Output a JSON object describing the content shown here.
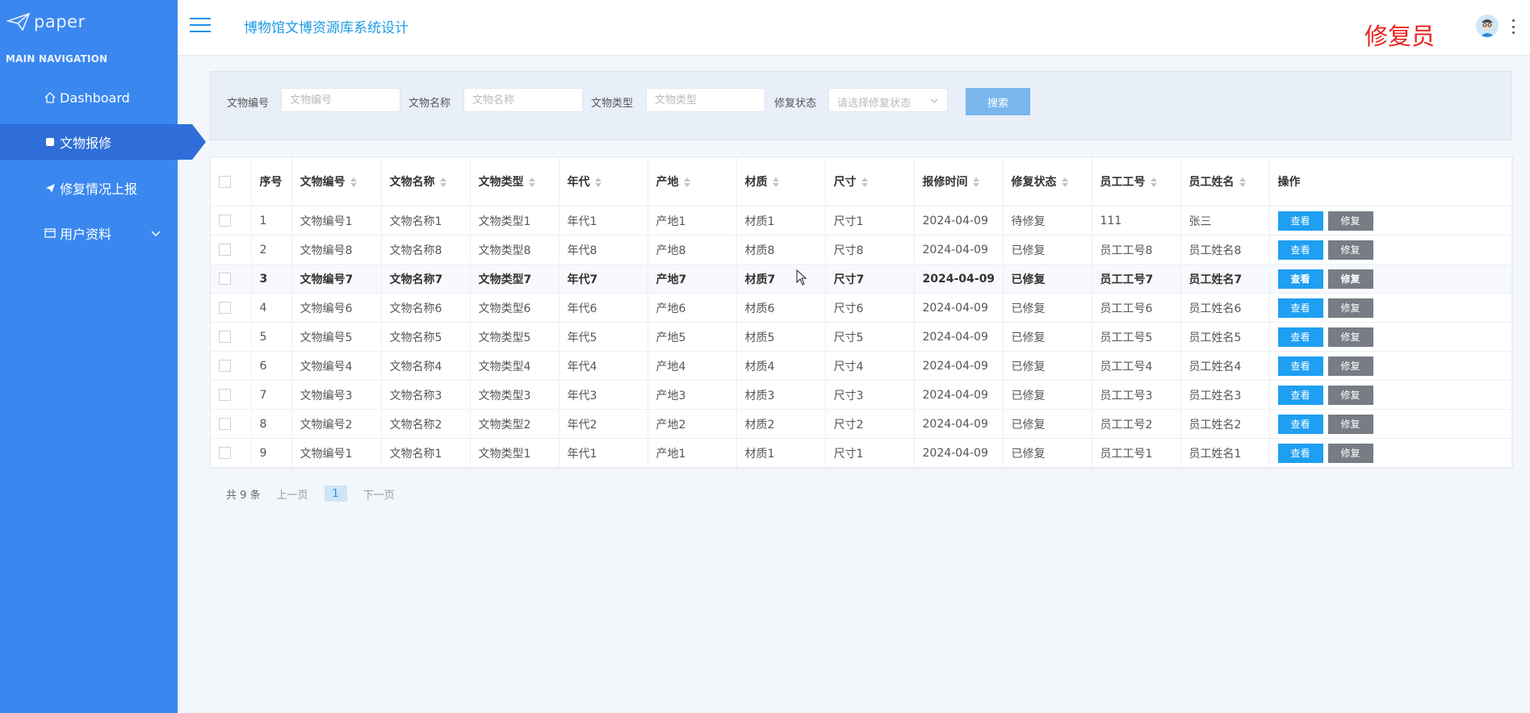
{
  "sidebar": {
    "logo_text": "paper",
    "nav_header": "MAIN NAVIGATION",
    "items": [
      {
        "label": "Dashboard",
        "icon": "home-icon"
      },
      {
        "label": "文物报修",
        "icon": "box-icon"
      },
      {
        "label": "修复情况上报",
        "icon": "paper-plane-icon"
      },
      {
        "label": "用户资料",
        "icon": "id-card-icon"
      }
    ]
  },
  "header": {
    "title": "博物馆文博资源库系统设计",
    "role": "修复员"
  },
  "search": {
    "fields": [
      {
        "label": "文物编号",
        "placeholder": "文物编号"
      },
      {
        "label": "文物名称",
        "placeholder": "文物名称"
      },
      {
        "label": "文物类型",
        "placeholder": "文物类型"
      },
      {
        "label": "修复状态",
        "placeholder": "请选择修复状态"
      }
    ],
    "button": "搜索"
  },
  "table": {
    "columns": [
      "序号",
      "文物编号",
      "文物名称",
      "文物类型",
      "年代",
      "产地",
      "材质",
      "尺寸",
      "报修时间",
      "修复状态",
      "员工工号",
      "员工姓名",
      "操作"
    ],
    "view_label": "查看",
    "fix_label": "修复",
    "rows": [
      [
        "1",
        "文物编号1",
        "文物名称1",
        "文物类型1",
        "年代1",
        "产地1",
        "材质1",
        "尺寸1",
        "2024-04-09",
        "待修复",
        "111",
        "张三"
      ],
      [
        "2",
        "文物编号8",
        "文物名称8",
        "文物类型8",
        "年代8",
        "产地8",
        "材质8",
        "尺寸8",
        "2024-04-09",
        "已修复",
        "员工工号8",
        "员工姓名8"
      ],
      [
        "3",
        "文物编号7",
        "文物名称7",
        "文物类型7",
        "年代7",
        "产地7",
        "材质7",
        "尺寸7",
        "2024-04-09",
        "已修复",
        "员工工号7",
        "员工姓名7"
      ],
      [
        "4",
        "文物编号6",
        "文物名称6",
        "文物类型6",
        "年代6",
        "产地6",
        "材质6",
        "尺寸6",
        "2024-04-09",
        "已修复",
        "员工工号6",
        "员工姓名6"
      ],
      [
        "5",
        "文物编号5",
        "文物名称5",
        "文物类型5",
        "年代5",
        "产地5",
        "材质5",
        "尺寸5",
        "2024-04-09",
        "已修复",
        "员工工号5",
        "员工姓名5"
      ],
      [
        "6",
        "文物编号4",
        "文物名称4",
        "文物类型4",
        "年代4",
        "产地4",
        "材质4",
        "尺寸4",
        "2024-04-09",
        "已修复",
        "员工工号4",
        "员工姓名4"
      ],
      [
        "7",
        "文物编号3",
        "文物名称3",
        "文物类型3",
        "年代3",
        "产地3",
        "材质3",
        "尺寸3",
        "2024-04-09",
        "已修复",
        "员工工号3",
        "员工姓名3"
      ],
      [
        "8",
        "文物编号2",
        "文物名称2",
        "文物类型2",
        "年代2",
        "产地2",
        "材质2",
        "尺寸2",
        "2024-04-09",
        "已修复",
        "员工工号2",
        "员工姓名2"
      ],
      [
        "9",
        "文物编号1",
        "文物名称1",
        "文物类型1",
        "年代1",
        "产地1",
        "材质1",
        "尺寸1",
        "2024-04-09",
        "已修复",
        "员工工号1",
        "员工姓名1"
      ]
    ],
    "hovered_row": 3
  },
  "pagination": {
    "total": "共 9 条",
    "prev": "上一页",
    "current": "1",
    "next": "下一页"
  },
  "colors": {
    "sidebar": "#3a87f0",
    "accent": "#1e9ff2",
    "role": "#e9231c"
  }
}
